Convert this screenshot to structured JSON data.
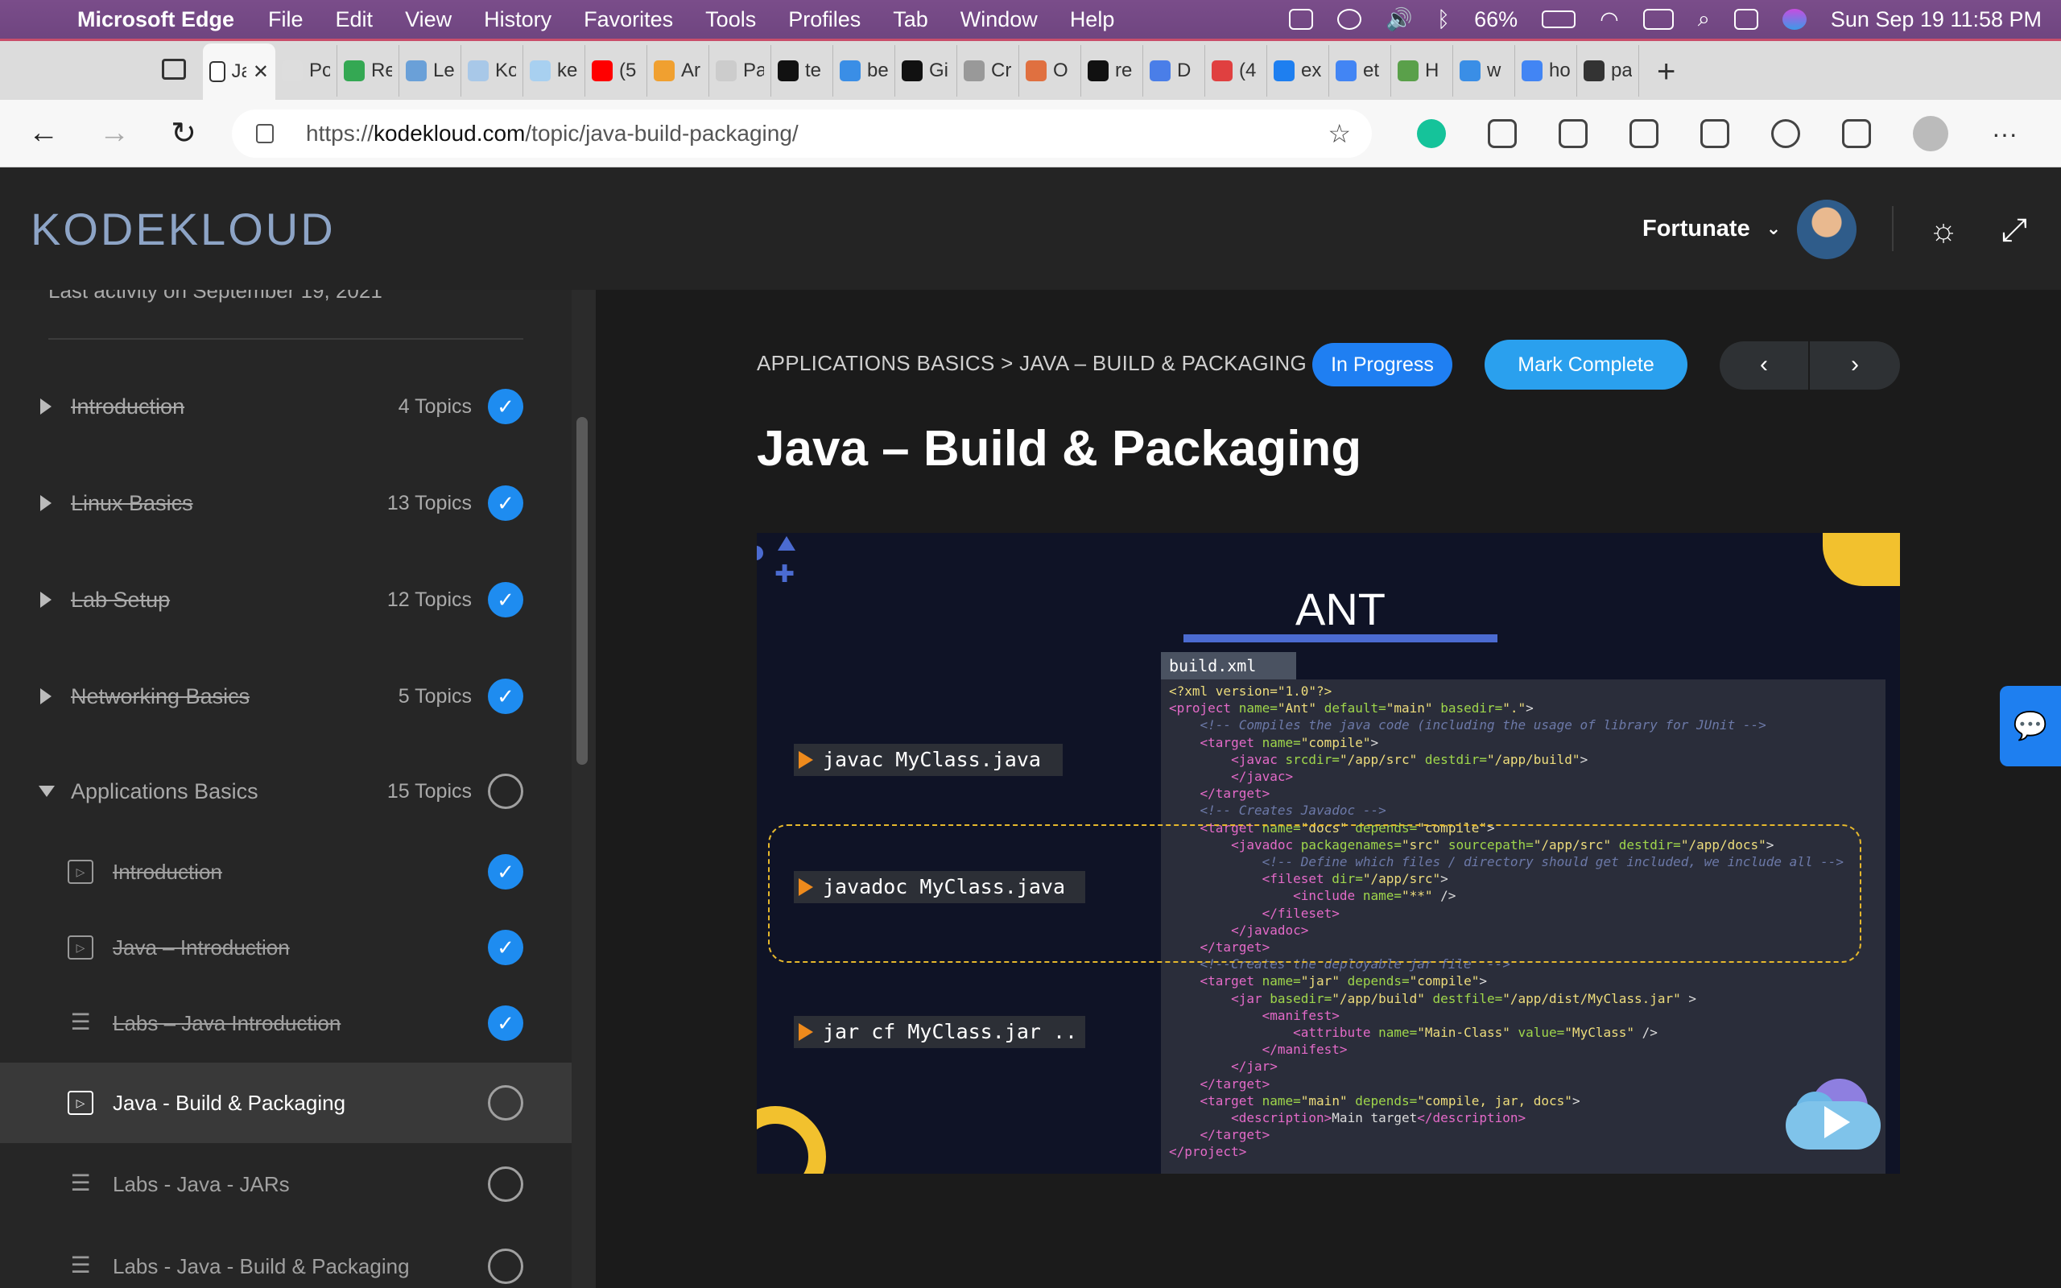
{
  "menubar": {
    "app_name": "Microsoft Edge",
    "items": [
      "File",
      "Edit",
      "View",
      "History",
      "Favorites",
      "Tools",
      "Profiles",
      "Tab",
      "Window",
      "Help"
    ],
    "battery": "66%",
    "datetime": "Sun Sep 19  11:58 PM"
  },
  "tabs": [
    {
      "title": "Ja",
      "color": "#ffffff",
      "active": true
    },
    {
      "title": "Po",
      "color": "#dddddd"
    },
    {
      "title": "Re",
      "color": "#34a853"
    },
    {
      "title": "Le",
      "color": "#6aa0d8"
    },
    {
      "title": "Ko",
      "color": "#a8c8e8"
    },
    {
      "title": "ke",
      "color": "#a8d0f0"
    },
    {
      "title": "(5",
      "color": "#ff0000"
    },
    {
      "title": "Ar",
      "color": "#f0a030"
    },
    {
      "title": "Pa",
      "color": "#cccccc"
    },
    {
      "title": "te",
      "color": "#111111"
    },
    {
      "title": "be",
      "color": "#3a8ee6"
    },
    {
      "title": "Gi",
      "color": "#111111"
    },
    {
      "title": "Cr",
      "color": "#999999"
    },
    {
      "title": "O",
      "color": "#e07040"
    },
    {
      "title": "re",
      "color": "#111111"
    },
    {
      "title": "D",
      "color": "#4a7ee8"
    },
    {
      "title": "(4",
      "color": "#e04040"
    },
    {
      "title": "ex",
      "color": "#1e7ff0"
    },
    {
      "title": "et",
      "color": "#4285f4"
    },
    {
      "title": "H",
      "color": "#5aa04a"
    },
    {
      "title": "w",
      "color": "#3a8ee6"
    },
    {
      "title": "ho",
      "color": "#4285f4"
    },
    {
      "title": "pa",
      "color": "#333333"
    }
  ],
  "url": {
    "prefix": "https://",
    "host": "kodekloud.com",
    "path": "/topic/java-build-packaging/"
  },
  "header": {
    "logo": "KODEKLOUD",
    "username": "Fortunate"
  },
  "sidebar": {
    "last_activity": "Last activity on September 19, 2021",
    "sections": [
      {
        "label": "Introduction",
        "count": "4 Topics",
        "done": true
      },
      {
        "label": "Linux Basics",
        "count": "13 Topics",
        "done": true
      },
      {
        "label": "Lab Setup",
        "count": "12 Topics",
        "done": true
      },
      {
        "label": "Networking Basics",
        "count": "5 Topics",
        "done": true
      },
      {
        "label": "Applications Basics",
        "count": "15 Topics",
        "done": false
      }
    ],
    "lessons": [
      {
        "label": "Introduction",
        "type": "video",
        "done": true
      },
      {
        "label": "Java – Introduction",
        "type": "video",
        "done": true
      },
      {
        "label": "Labs – Java Introduction",
        "type": "text",
        "done": true
      },
      {
        "label": "Java - Build & Packaging",
        "type": "video",
        "done": false,
        "active": true
      },
      {
        "label": "Labs - Java - JARs",
        "type": "text",
        "done": false
      },
      {
        "label": "Labs - Java - Build & Packaging",
        "type": "text",
        "done": false
      }
    ]
  },
  "main": {
    "breadcrumb": "APPLICATIONS BASICS > JAVA – BUILD & PACKAGING",
    "status": "In Progress",
    "mark_complete": "Mark Complete",
    "prev": "‹",
    "next": "›",
    "title": "Java – Build & Packaging"
  },
  "slide": {
    "heading": "ANT",
    "file_tab": "build.xml",
    "commands": [
      "javac MyClass.java",
      "javadoc MyClass.java",
      "jar cf MyClass.jar .."
    ]
  },
  "colors": {
    "accent_blue": "#1e8cf0",
    "slide_yellow": "#f2c12e",
    "ant_bar": "#4b6bd1"
  }
}
